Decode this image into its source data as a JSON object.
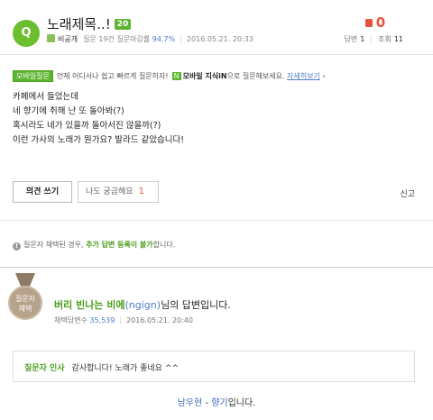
{
  "question": {
    "badge": "Q",
    "title": "노래제목..!",
    "grade": "20",
    "author": "비공개",
    "author_stats_prefix": "질문 19건 질문마감률",
    "close_rate": "94.7%",
    "date": "2016.05.21. 20:33",
    "likes": "0",
    "answers_label": "답변",
    "answers": "1",
    "views_label": "조회",
    "views": "11",
    "body": [
      "카페에서 들었는데",
      "네 향기에 취해 난 또 돌아봐(?)",
      "혹시라도 네가 있을까 돌아서진 않을까(?)",
      "이런 가사의 노래가 뭔가요? 발라드 같았습니다!"
    ]
  },
  "mobile": {
    "tag": "모바일질문",
    "text1": "언제 어디서나 쉽고 빠르게 질문하자!",
    "tag2": "N",
    "text2_strong": "모바일 지식iN",
    "text2": "으로 질문해보세요.",
    "link": "자세히보기"
  },
  "buttons": {
    "answer": "의견 쓰기",
    "curious": "나도 궁금해요",
    "curious_count": "1",
    "report": "신고"
  },
  "notice": {
    "text1": "질문자 채택된 경우,",
    "highlight": "추가 답변 등록이 불가",
    "text2": "합니다."
  },
  "answer": {
    "medal_line1": "질문자",
    "medal_line2": "채택",
    "name": "버리 빈나는 비에",
    "nick": "(ngign)",
    "suffix": "님의 답변입니다.",
    "adopt_label": "채택답변수",
    "adopt_count": "35,539",
    "date": "2016.05.21. 20:40"
  },
  "greeting": {
    "label": "질문자 인사",
    "text": "감사합니다! 노래가 좋네요 ^^"
  },
  "signature": {
    "artist": "남우현",
    "dash": " - ",
    "song": "향기",
    "suffix": "입니다."
  }
}
